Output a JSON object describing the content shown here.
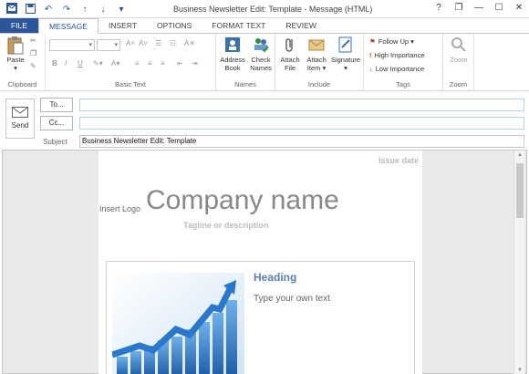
{
  "window": {
    "title": "Business Newsletter Edit: Template - Message (HTML)",
    "controls": [
      "?",
      "❐",
      "—",
      "☐",
      "✕"
    ]
  },
  "tabs": [
    {
      "label": "FILE"
    },
    {
      "label": "MESSAGE"
    },
    {
      "label": "INSERT"
    },
    {
      "label": "OPTIONS"
    },
    {
      "label": "FORMAT TEXT"
    },
    {
      "label": "REVIEW"
    }
  ],
  "ribbon": {
    "clipboard": {
      "paste": "Paste",
      "label": "Clipboard"
    },
    "basic_text": {
      "label": "Basic Text",
      "bold": "B",
      "italic": "I",
      "underline": "U"
    },
    "names": {
      "address_book": [
        "Address",
        "Book"
      ],
      "check_names": [
        "Check",
        "Names"
      ],
      "label": "Names"
    },
    "include": {
      "attach_file": [
        "Attach",
        "File"
      ],
      "attach_item": [
        "Attach",
        "Item ▾"
      ],
      "signature": [
        "Signature",
        "▾"
      ],
      "label": "Include"
    },
    "tags": {
      "follow_up": "Follow Up ▾",
      "high_importance": "High Importance",
      "low_importance": "Low Importance",
      "label": "Tags"
    },
    "zoom": {
      "zoom": "Zoom",
      "label": "Zoom"
    }
  },
  "compose": {
    "send": "Send",
    "to": "To...",
    "cc": "Cc...",
    "subject_label": "Subject",
    "to_value": "",
    "cc_value": "",
    "subject_value": "Business Newsletter Edit: Template"
  },
  "newsletter": {
    "issue_date": "Issue date",
    "insert_logo": "Insert Logo",
    "company_name": "Company name",
    "tagline": "Tagline or description",
    "heading": "Heading",
    "body_text": "Type your own text"
  },
  "colors": {
    "accent": "#2b579a",
    "heading": "#5b7fb0"
  }
}
